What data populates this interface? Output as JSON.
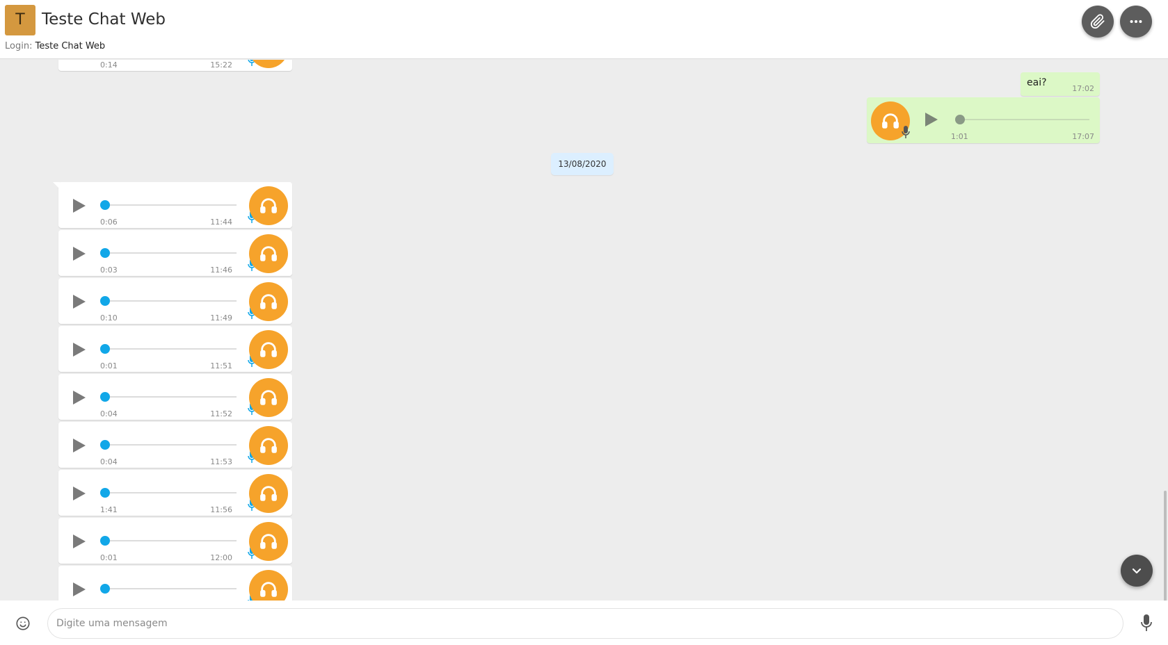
{
  "header": {
    "avatar_letter": "T",
    "title": "Teste Chat Web",
    "login_label": "Login:",
    "login_value": "Teste Chat Web"
  },
  "icons": {
    "attach": "paperclip-icon",
    "more": "more-horizontal-icon",
    "play": "play-icon",
    "headphones": "headphones-icon",
    "mic": "microphone-icon",
    "scroll_down": "chevron-down-icon",
    "emoji": "smiley-icon"
  },
  "colors": {
    "accent_orange": "#f6a32b",
    "progress_blue": "#11a7e8",
    "outgoing_bubble": "#dcf8c6",
    "date_chip": "#dcefff",
    "avatar": "#d4983f"
  },
  "messages": {
    "top_partial": {
      "duration": "0:14",
      "time": "15:22"
    },
    "outgoing_text": {
      "text": "eai?",
      "time": "17:02"
    },
    "outgoing_audio": {
      "duration": "1:01",
      "time": "17:07"
    },
    "date_separator": "13/08/2020",
    "incoming_audios": [
      {
        "duration": "0:06",
        "time": "11:44"
      },
      {
        "duration": "0:03",
        "time": "11:46"
      },
      {
        "duration": "0:10",
        "time": "11:49"
      },
      {
        "duration": "0:01",
        "time": "11:51"
      },
      {
        "duration": "0:04",
        "time": "11:52"
      },
      {
        "duration": "0:04",
        "time": "11:53"
      },
      {
        "duration": "1:41",
        "time": "11:56"
      },
      {
        "duration": "0:01",
        "time": "12:00"
      },
      {
        "duration": "",
        "time": ""
      }
    ]
  },
  "composer": {
    "placeholder": "Digite uma mensagem"
  }
}
